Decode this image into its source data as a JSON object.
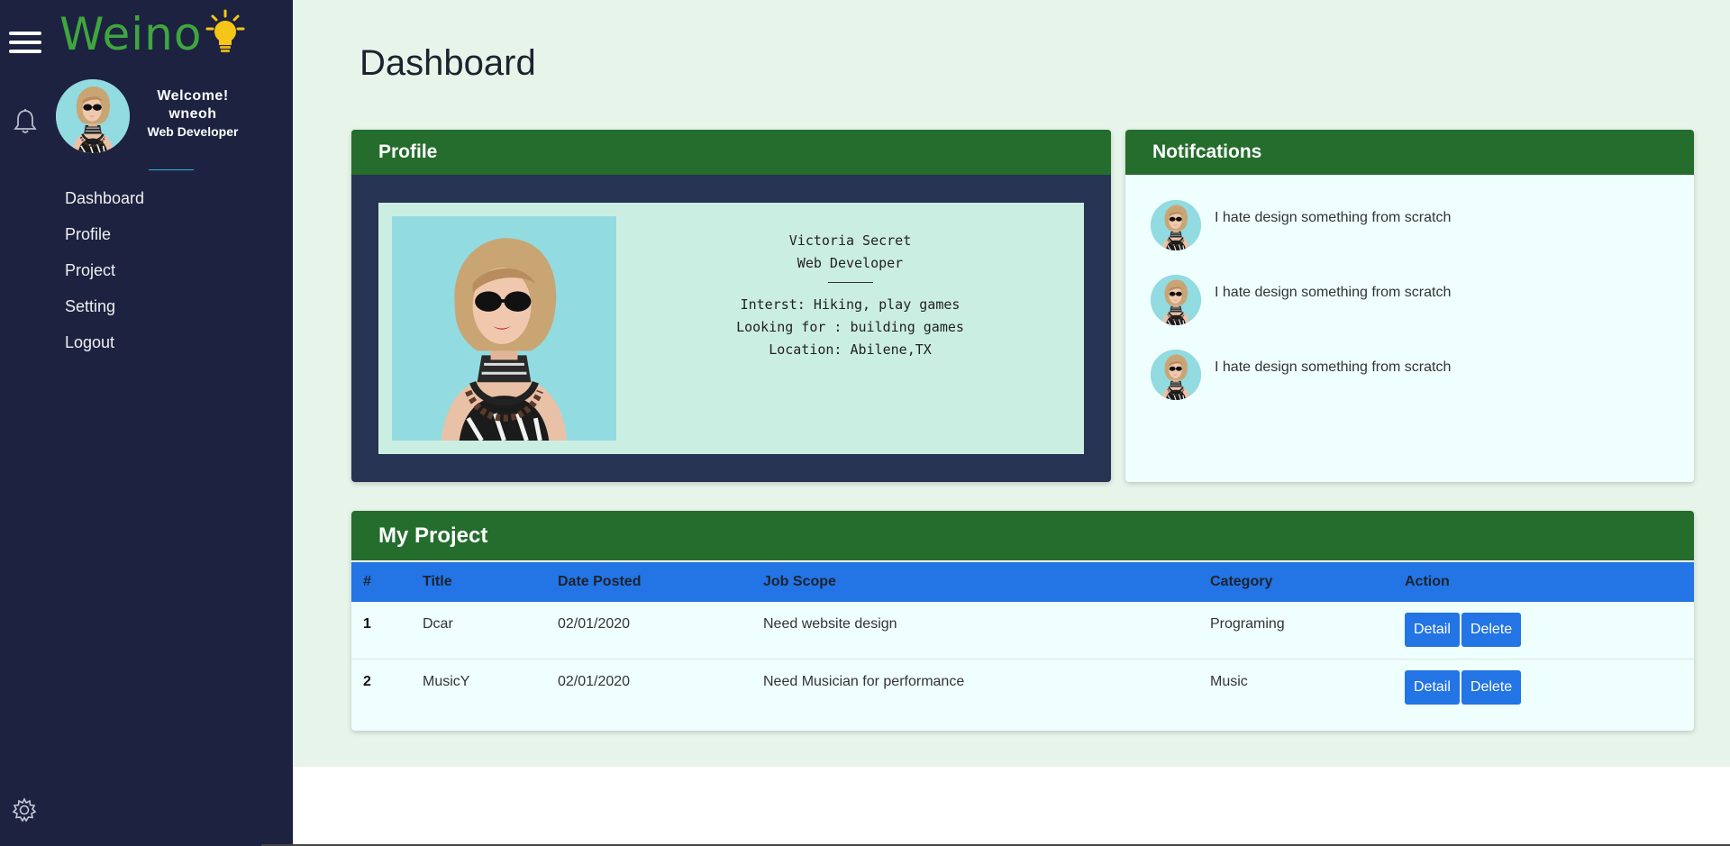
{
  "brand": {
    "name": "Weino",
    "accent": "#3fa63f",
    "bulb_color": "#f5c518"
  },
  "icons": {
    "menu": "hamburger-icon",
    "bell": "bell-icon",
    "settings": "gear-icon"
  },
  "user": {
    "welcome": "Welcome!",
    "username": "wneoh",
    "role": "Web Developer"
  },
  "sidebar": {
    "items": [
      {
        "label": "Dashboard"
      },
      {
        "label": "Profile"
      },
      {
        "label": "Project"
      },
      {
        "label": "Setting"
      },
      {
        "label": "Logout"
      }
    ]
  },
  "page": {
    "title": "Dashboard"
  },
  "profile": {
    "header": "Profile",
    "name": "Victoria Secret",
    "role": "Web Developer",
    "interest": "Interst: Hiking, play games",
    "looking_for": "Looking for : building games",
    "location": "Location: Abilene,TX"
  },
  "notifications": {
    "header": "Notifcations",
    "items": [
      {
        "text": "I hate design something from scratch"
      },
      {
        "text": "I hate design something from scratch"
      },
      {
        "text": "I hate design something from scratch"
      }
    ]
  },
  "projects": {
    "header": "My Project",
    "columns": [
      "#",
      "Title",
      "Date Posted",
      "Job Scope",
      "Category",
      "Action"
    ],
    "rows": [
      {
        "num": "1",
        "title": "Dcar",
        "date": "02/01/2020",
        "scope": "Need website design",
        "category": "Programing"
      },
      {
        "num": "2",
        "title": "MusicY",
        "date": "02/01/2020",
        "scope": "Need Musician for performance",
        "category": "Music"
      }
    ],
    "detail_label": "Detail",
    "delete_label": "Delete"
  },
  "colors": {
    "sidebar": "#1d2240",
    "header_green": "#246d2d",
    "table_header": "#2374e5",
    "profile_bg": "#263352"
  }
}
